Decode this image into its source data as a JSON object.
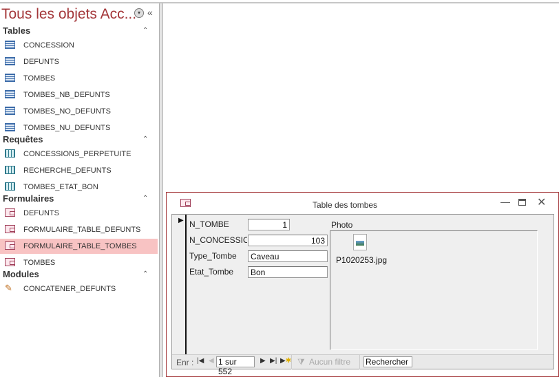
{
  "nav_pane": {
    "title": "Tous les objets Acc...",
    "menu_icon": "circle-chevron-down-icon",
    "collapse_icon": "double-chevron-left-icon",
    "sections": [
      {
        "label": "Tables",
        "items": [
          "CONCESSION",
          "DEFUNTS",
          "TOMBES",
          "TOMBES_NB_DEFUNTS",
          "TOMBES_NO_DEFUNTS",
          "TOMBES_NU_DEFUNTS"
        ]
      },
      {
        "label": "Requêtes",
        "items": [
          "CONCESSIONS_PERPETUITE",
          "RECHERCHE_DEFUNTS",
          "TOMBES_ETAT_BON"
        ]
      },
      {
        "label": "Formulaires",
        "items": [
          "DEFUNTS",
          "FORMULAIRE_TABLE_DEFUNTS",
          "FORMULAIRE_TABLE_TOMBES",
          "TOMBES"
        ]
      },
      {
        "label": "Modules",
        "items": [
          "CONCATENER_DEFUNTS"
        ]
      }
    ],
    "selected_item": "FORMULAIRE_TABLE_TOMBES",
    "title_color": "#a4373a",
    "selected_color": "#f8c3c3"
  },
  "form_window": {
    "title": "Table des tombes",
    "fields": [
      {
        "label": "N_TOMBE",
        "value": "1"
      },
      {
        "label": "N_CONCESSION",
        "value": "103"
      },
      {
        "label": "Type_Tombe",
        "value": "Caveau"
      },
      {
        "label": "Etat_Tombe",
        "value": "Bon"
      }
    ],
    "photo_label": "Photo",
    "photo_file": "P1020253.jpg",
    "navigation": {
      "label": "Enr :",
      "record": "1 sur 552",
      "filter": "Aucun filtre",
      "search": "Rechercher"
    }
  }
}
